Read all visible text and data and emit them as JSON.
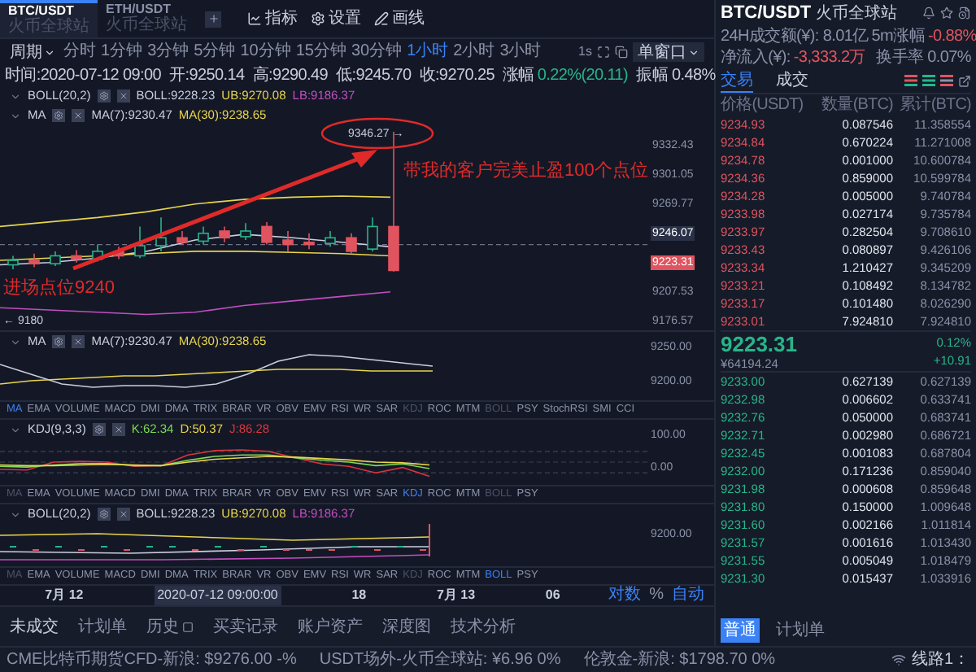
{
  "pair_tabs": [
    {
      "symbol": "BTC/USDT",
      "exchange": "火币全球站",
      "selected": true
    },
    {
      "symbol": "ETH/USDT",
      "exchange": "火币全球站",
      "selected": false
    }
  ],
  "tools": [
    {
      "label": "指标",
      "kind": "chart"
    },
    {
      "label": "设置",
      "kind": "gear"
    },
    {
      "label": "画线",
      "kind": "pen"
    }
  ],
  "period_label": "周期",
  "periods": [
    {
      "label": "分时",
      "selected": false
    },
    {
      "label": "1分钟",
      "selected": false
    },
    {
      "label": "3分钟",
      "selected": false
    },
    {
      "label": "5分钟",
      "selected": false
    },
    {
      "label": "10分钟",
      "selected": false
    },
    {
      "label": "15分钟",
      "selected": false
    },
    {
      "label": "30分钟",
      "selected": false
    },
    {
      "label": "1小时",
      "selected": true
    },
    {
      "label": "2小时",
      "selected": false
    },
    {
      "label": "3小时",
      "selected": false
    }
  ],
  "interval": "1s",
  "window_mode": "单窗口",
  "ohlc": [
    "时间:2020-07-12 09:00",
    "开:9250.14",
    "高:9290.49",
    "低:9245.70",
    "收:9270.25"
  ],
  "change": {
    "label": "涨幅",
    "value": "0.22%(20.11)"
  },
  "amplitude": "振幅 0.48%",
  "main_indicators": [
    {
      "name": "BOLL(20,2)",
      "values": [
        {
          "text": "BOLL:9228.23",
          "color": "#c9cede"
        },
        {
          "text": "UB:9270.08",
          "color": "#e8d44d"
        },
        {
          "text": "LB:9186.37",
          "color": "#c04fc0"
        }
      ]
    },
    {
      "name": "MA",
      "values": [
        {
          "text": "MA(7):9230.47",
          "color": "#c9cede"
        },
        {
          "text": "MA(30):9238.65",
          "color": "#e8d44d"
        }
      ]
    }
  ],
  "max_marker": "9346.27 →",
  "min_marker": "← 9180",
  "price_axis": [
    {
      "text": "9332.43",
      "kind": "tick"
    },
    {
      "text": "9301.05",
      "kind": "tick"
    },
    {
      "text": "9269.77",
      "kind": "tick"
    },
    {
      "text": "9246.07",
      "kind": "crosshair"
    },
    {
      "text": "9223.31",
      "kind": "last"
    },
    {
      "text": "9207.53",
      "kind": "tick"
    },
    {
      "text": "9176.57",
      "kind": "tick"
    }
  ],
  "annotations": [
    {
      "text": "带我的客户完美止盈100个点位",
      "kind": "target"
    },
    {
      "text": "进场点位9240",
      "kind": "entry"
    }
  ],
  "sub_panels": [
    {
      "indicator": {
        "name": "MA",
        "values": [
          {
            "text": "MA(7):9230.47",
            "color": "#c9cede"
          },
          {
            "text": "MA(30):9238.65",
            "color": "#e8d44d"
          }
        ]
      },
      "kind": "ma",
      "axis": [
        "9250.00",
        "9200.00"
      ],
      "tabs": [
        {
          "label": "MA",
          "selected": true,
          "disabled": false
        },
        {
          "label": "EMA",
          "selected": false,
          "disabled": false
        },
        {
          "label": "VOLUME",
          "selected": false,
          "disabled": false
        },
        {
          "label": "MACD",
          "selected": false,
          "disabled": false
        },
        {
          "label": "DMI",
          "selected": false,
          "disabled": false
        },
        {
          "label": "DMA",
          "selected": false,
          "disabled": false
        },
        {
          "label": "TRIX",
          "selected": false,
          "disabled": false
        },
        {
          "label": "BRAR",
          "selected": false,
          "disabled": false
        },
        {
          "label": "VR",
          "selected": false,
          "disabled": false
        },
        {
          "label": "OBV",
          "selected": false,
          "disabled": false
        },
        {
          "label": "EMV",
          "selected": false,
          "disabled": false
        },
        {
          "label": "RSI",
          "selected": false,
          "disabled": false
        },
        {
          "label": "WR",
          "selected": false,
          "disabled": false
        },
        {
          "label": "SAR",
          "selected": false,
          "disabled": false
        },
        {
          "label": "KDJ",
          "selected": false,
          "disabled": true
        },
        {
          "label": "ROC",
          "selected": false,
          "disabled": false
        },
        {
          "label": "MTM",
          "selected": false,
          "disabled": false
        },
        {
          "label": "BOLL",
          "selected": false,
          "disabled": true
        },
        {
          "label": "PSY",
          "selected": false,
          "disabled": false
        },
        {
          "label": "StochRSI",
          "selected": false,
          "disabled": false
        },
        {
          "label": "SMI",
          "selected": false,
          "disabled": false
        },
        {
          "label": "CCI",
          "selected": false,
          "disabled": false
        }
      ]
    },
    {
      "indicator": {
        "name": "KDJ(9,3,3)",
        "values": [
          {
            "text": "K:62.34",
            "color": "#7ed957"
          },
          {
            "text": "D:50.37",
            "color": "#e8d44d"
          },
          {
            "text": "J:86.28",
            "color": "#d9363e"
          }
        ]
      },
      "kind": "kdj",
      "axis": [
        "100.00",
        "0.00"
      ],
      "tabs": [
        {
          "label": "MA",
          "selected": false,
          "disabled": true
        },
        {
          "label": "EMA",
          "selected": false,
          "disabled": false
        },
        {
          "label": "VOLUME",
          "selected": false,
          "disabled": false
        },
        {
          "label": "MACD",
          "selected": false,
          "disabled": false
        },
        {
          "label": "DMI",
          "selected": false,
          "disabled": false
        },
        {
          "label": "DMA",
          "selected": false,
          "disabled": false
        },
        {
          "label": "TRIX",
          "selected": false,
          "disabled": false
        },
        {
          "label": "BRAR",
          "selected": false,
          "disabled": false
        },
        {
          "label": "VR",
          "selected": false,
          "disabled": false
        },
        {
          "label": "OBV",
          "selected": false,
          "disabled": false
        },
        {
          "label": "EMV",
          "selected": false,
          "disabled": false
        },
        {
          "label": "RSI",
          "selected": false,
          "disabled": false
        },
        {
          "label": "WR",
          "selected": false,
          "disabled": false
        },
        {
          "label": "SAR",
          "selected": false,
          "disabled": false
        },
        {
          "label": "KDJ",
          "selected": true,
          "disabled": false
        },
        {
          "label": "ROC",
          "selected": false,
          "disabled": false
        },
        {
          "label": "MTM",
          "selected": false,
          "disabled": false
        },
        {
          "label": "BOLL",
          "selected": false,
          "disabled": true
        },
        {
          "label": "PSY",
          "selected": false,
          "disabled": false
        }
      ]
    },
    {
      "indicator": {
        "name": "BOLL(20,2)",
        "values": [
          {
            "text": "BOLL:9228.23",
            "color": "#c9cede"
          },
          {
            "text": "UB:9270.08",
            "color": "#e8d44d"
          },
          {
            "text": "LB:9186.37",
            "color": "#c04fc0"
          }
        ]
      },
      "kind": "boll",
      "axis": [
        "9200.00"
      ],
      "tabs": [
        {
          "label": "MA",
          "selected": false,
          "disabled": true
        },
        {
          "label": "EMA",
          "selected": false,
          "disabled": false
        },
        {
          "label": "VOLUME",
          "selected": false,
          "disabled": false
        },
        {
          "label": "MACD",
          "selected": false,
          "disabled": false
        },
        {
          "label": "DMI",
          "selected": false,
          "disabled": false
        },
        {
          "label": "DMA",
          "selected": false,
          "disabled": false
        },
        {
          "label": "TRIX",
          "selected": false,
          "disabled": false
        },
        {
          "label": "BRAR",
          "selected": false,
          "disabled": false
        },
        {
          "label": "VR",
          "selected": false,
          "disabled": false
        },
        {
          "label": "OBV",
          "selected": false,
          "disabled": false
        },
        {
          "label": "EMV",
          "selected": false,
          "disabled": false
        },
        {
          "label": "RSI",
          "selected": false,
          "disabled": false
        },
        {
          "label": "WR",
          "selected": false,
          "disabled": false
        },
        {
          "label": "SAR",
          "selected": false,
          "disabled": false
        },
        {
          "label": "KDJ",
          "selected": false,
          "disabled": true
        },
        {
          "label": "ROC",
          "selected": false,
          "disabled": false
        },
        {
          "label": "MTM",
          "selected": false,
          "disabled": false
        },
        {
          "label": "BOLL",
          "selected": true,
          "disabled": false
        },
        {
          "label": "PSY",
          "selected": false,
          "disabled": false
        }
      ]
    }
  ],
  "time_axis": [
    {
      "text": "7月 12",
      "kind": "label"
    },
    {
      "text": "2020-07-12 09:00:00",
      "kind": "cursor"
    },
    {
      "text": "18",
      "kind": "label"
    },
    {
      "text": "7月 13",
      "kind": "label"
    },
    {
      "text": "06",
      "kind": "label"
    }
  ],
  "scale_options": [
    {
      "label": "对数",
      "selected": true
    },
    {
      "label": "%",
      "selected": false
    },
    {
      "label": "自动",
      "selected": true
    }
  ],
  "bottom_tabs": [
    {
      "label": "未成交",
      "selected": true
    },
    {
      "label": "计划单",
      "selected": false
    },
    {
      "label": "历史",
      "selected": false
    },
    {
      "label": "买卖记录",
      "selected": false
    },
    {
      "label": "账户资产",
      "selected": false
    },
    {
      "label": "深度图",
      "selected": false
    },
    {
      "label": "技术分析",
      "selected": false
    }
  ],
  "market": {
    "symbol": "BTC/USDT",
    "exchange": "火币全球站",
    "volume": "24H成交额(¥): 8.01亿",
    "change_5m_label": "5m涨幅",
    "change_5m": "-0.88%",
    "inflow_label": "净流入(¥):",
    "inflow": "-3,333.2万",
    "turnover": "换手率 0.07%"
  },
  "book_tabs": [
    {
      "label": "交易",
      "selected": true
    },
    {
      "label": "成交",
      "selected": false
    }
  ],
  "book_columns": [
    "价格(USDT)",
    "数量(BTC)",
    "累计(BTC)"
  ],
  "asks": [
    {
      "price": "9234.93",
      "amount": "0.087546",
      "total": "11.358554"
    },
    {
      "price": "9234.84",
      "amount": "0.670224",
      "total": "11.271008"
    },
    {
      "price": "9234.78",
      "amount": "0.001000",
      "total": "10.600784"
    },
    {
      "price": "9234.36",
      "amount": "0.859000",
      "total": "10.599784"
    },
    {
      "price": "9234.28",
      "amount": "0.005000",
      "total": "9.740784"
    },
    {
      "price": "9233.98",
      "amount": "0.027174",
      "total": "9.735784"
    },
    {
      "price": "9233.97",
      "amount": "0.282504",
      "total": "9.708610"
    },
    {
      "price": "9233.43",
      "amount": "0.080897",
      "total": "9.426106"
    },
    {
      "price": "9233.34",
      "amount": "1.210427",
      "total": "9.345209"
    },
    {
      "price": "9233.21",
      "amount": "0.108492",
      "total": "8.134782"
    },
    {
      "price": "9233.17",
      "amount": "0.101480",
      "total": "8.026290"
    },
    {
      "price": "9233.01",
      "amount": "7.924810",
      "total": "7.924810"
    }
  ],
  "last_price": {
    "price": "9223.31",
    "cny": "¥64194.24",
    "percent": "0.12%",
    "change": "+10.91"
  },
  "bids": [
    {
      "price": "9233.00",
      "amount": "0.627139",
      "total": "0.627139"
    },
    {
      "price": "9232.98",
      "amount": "0.006602",
      "total": "0.633741"
    },
    {
      "price": "9232.76",
      "amount": "0.050000",
      "total": "0.683741"
    },
    {
      "price": "9232.71",
      "amount": "0.002980",
      "total": "0.686721"
    },
    {
      "price": "9232.45",
      "amount": "0.001083",
      "total": "0.687804"
    },
    {
      "price": "9232.00",
      "amount": "0.171236",
      "total": "0.859040"
    },
    {
      "price": "9231.98",
      "amount": "0.000608",
      "total": "0.859648"
    },
    {
      "price": "9231.80",
      "amount": "0.150000",
      "total": "1.009648"
    },
    {
      "price": "9231.60",
      "amount": "0.002166",
      "total": "1.011814"
    },
    {
      "price": "9231.57",
      "amount": "0.001616",
      "total": "1.013430"
    },
    {
      "price": "9231.55",
      "amount": "0.005049",
      "total": "1.018479"
    },
    {
      "price": "9231.30",
      "amount": "0.015437",
      "total": "1.033916"
    }
  ],
  "order_types": [
    {
      "label": "普通",
      "selected": true
    },
    {
      "label": "计划单",
      "selected": false
    }
  ],
  "status_bar": {
    "tickers": [
      "CME比特币期货CFD-新浪: $9276.00 -%",
      "USDT场外-火币全球站: ¥6.96 0%",
      "伦敦金-新浪: $1798.70 0%"
    ],
    "line": "线路1："
  }
}
